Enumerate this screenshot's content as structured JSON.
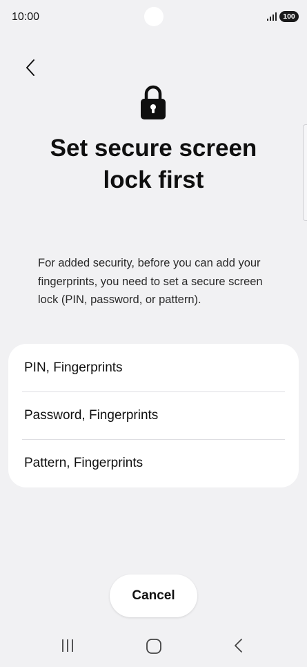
{
  "status_bar": {
    "time": "10:00",
    "battery": "100",
    "icons": [
      "signal-icon",
      "battery-icon"
    ]
  },
  "header": {
    "back_icon": "chevron-left-icon",
    "lock_icon": "lock-icon",
    "title": "Set secure screen lock first"
  },
  "description": "For added security, before you can add your fingerprints, you need to set a secure screen lock (PIN, password, or pattern).",
  "options": [
    {
      "label": "PIN, Fingerprints"
    },
    {
      "label": "Password, Fingerprints"
    },
    {
      "label": "Pattern, Fingerprints"
    }
  ],
  "cancel_label": "Cancel",
  "nav_bar": {
    "icons": [
      "recents-icon",
      "home-icon",
      "back-icon"
    ]
  },
  "colors": {
    "background": "#f1f1f3",
    "card": "#ffffff",
    "text": "#111111"
  }
}
